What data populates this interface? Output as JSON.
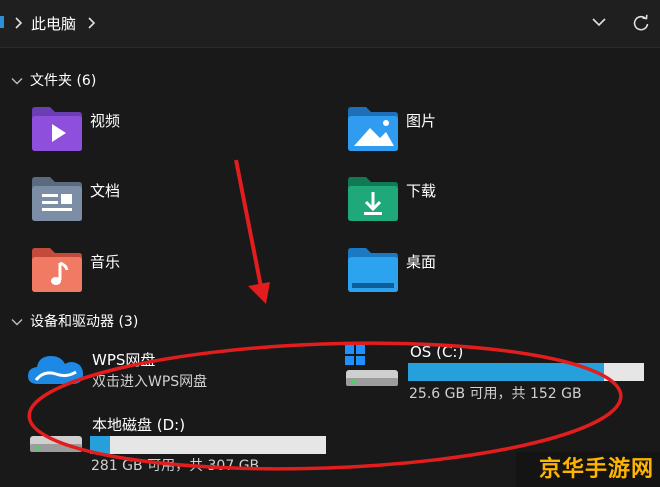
{
  "address_bar": {
    "path_label": "此电脑"
  },
  "sections": {
    "folders": {
      "label": "文件夹 (6)"
    },
    "devices": {
      "label": "设备和驱动器 (3)"
    }
  },
  "folders": [
    {
      "name": "视频",
      "icon": "videos-folder-icon"
    },
    {
      "name": "图片",
      "icon": "pictures-folder-icon"
    },
    {
      "name": "文档",
      "icon": "documents-folder-icon"
    },
    {
      "name": "下载",
      "icon": "downloads-folder-icon"
    },
    {
      "name": "音乐",
      "icon": "music-folder-icon"
    },
    {
      "name": "桌面",
      "icon": "desktop-folder-icon"
    }
  ],
  "drives": [
    {
      "name": "WPS网盘",
      "subtitle": "双击进入WPS网盘",
      "icon": "wps-cloud-icon"
    },
    {
      "name": "OS (C:)",
      "subtitle": "25.6 GB 可用，共 152 GB",
      "used_fraction": 0.832,
      "icon": "windows-drive-icon"
    },
    {
      "name": "本地磁盘 (D:)",
      "subtitle": "281 GB 可用，共 307 GB",
      "used_fraction": 0.085,
      "icon": "hard-drive-icon"
    }
  ],
  "watermark": {
    "text": "京华手游网"
  },
  "colors": {
    "background": "#191919",
    "usage_bar_fill": "#26a0da",
    "usage_bar_track": "#e6e6e6",
    "annotation_red": "#e21d1d",
    "watermark_text": "#ffb400"
  }
}
